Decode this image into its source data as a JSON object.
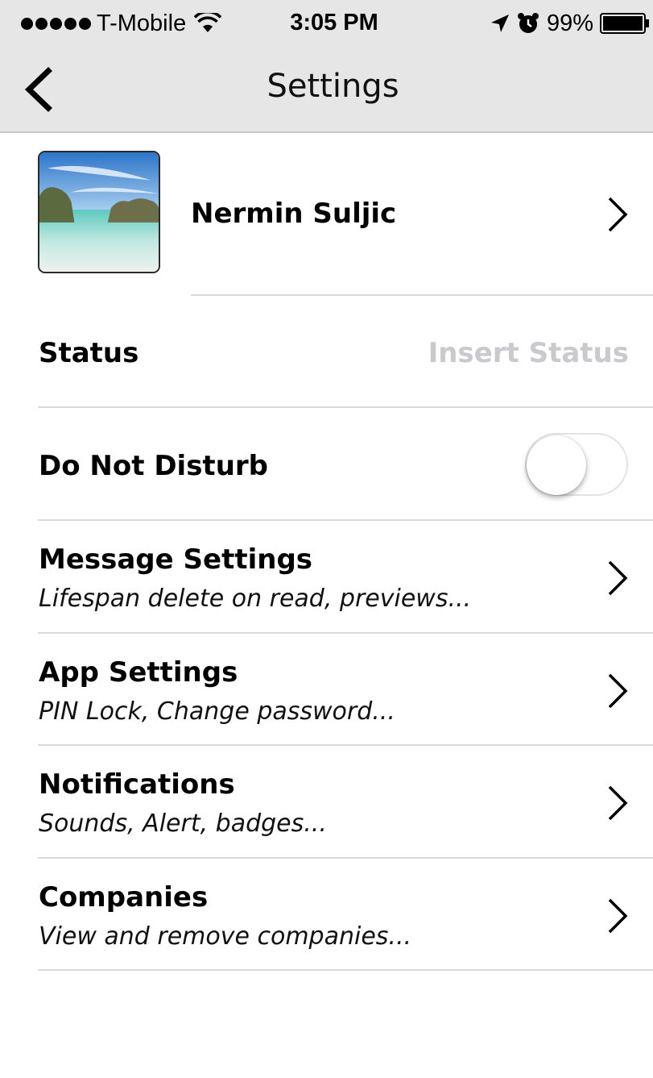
{
  "status_bar": {
    "carrier": "T-Mobile",
    "time": "3:05 PM",
    "battery": "99%",
    "icons": [
      "signal-dots",
      "wifi-icon",
      "location-arrow-icon",
      "alarm-clock-icon",
      "battery-icon"
    ]
  },
  "nav": {
    "title": "Settings",
    "back_icon": "chevron-left-icon"
  },
  "profile": {
    "name": "Nermin Suljic",
    "avatar": "beach-photo"
  },
  "status": {
    "label": "Status",
    "placeholder": "Insert Status"
  },
  "dnd": {
    "label": "Do Not Disturb",
    "enabled": false
  },
  "menu": [
    {
      "title": "Message Settings",
      "subtitle": "Lifespan delete on read, previews..."
    },
    {
      "title": "App Settings",
      "subtitle": "PIN Lock, Change password..."
    },
    {
      "title": "Notifications",
      "subtitle": "Sounds, Alert, badges..."
    },
    {
      "title": "Companies",
      "subtitle": "View and remove companies..."
    }
  ],
  "colors": {
    "bar_background": "#e6e6e6",
    "placeholder": "#c9c9ce",
    "divider": "#d9d9d9"
  }
}
